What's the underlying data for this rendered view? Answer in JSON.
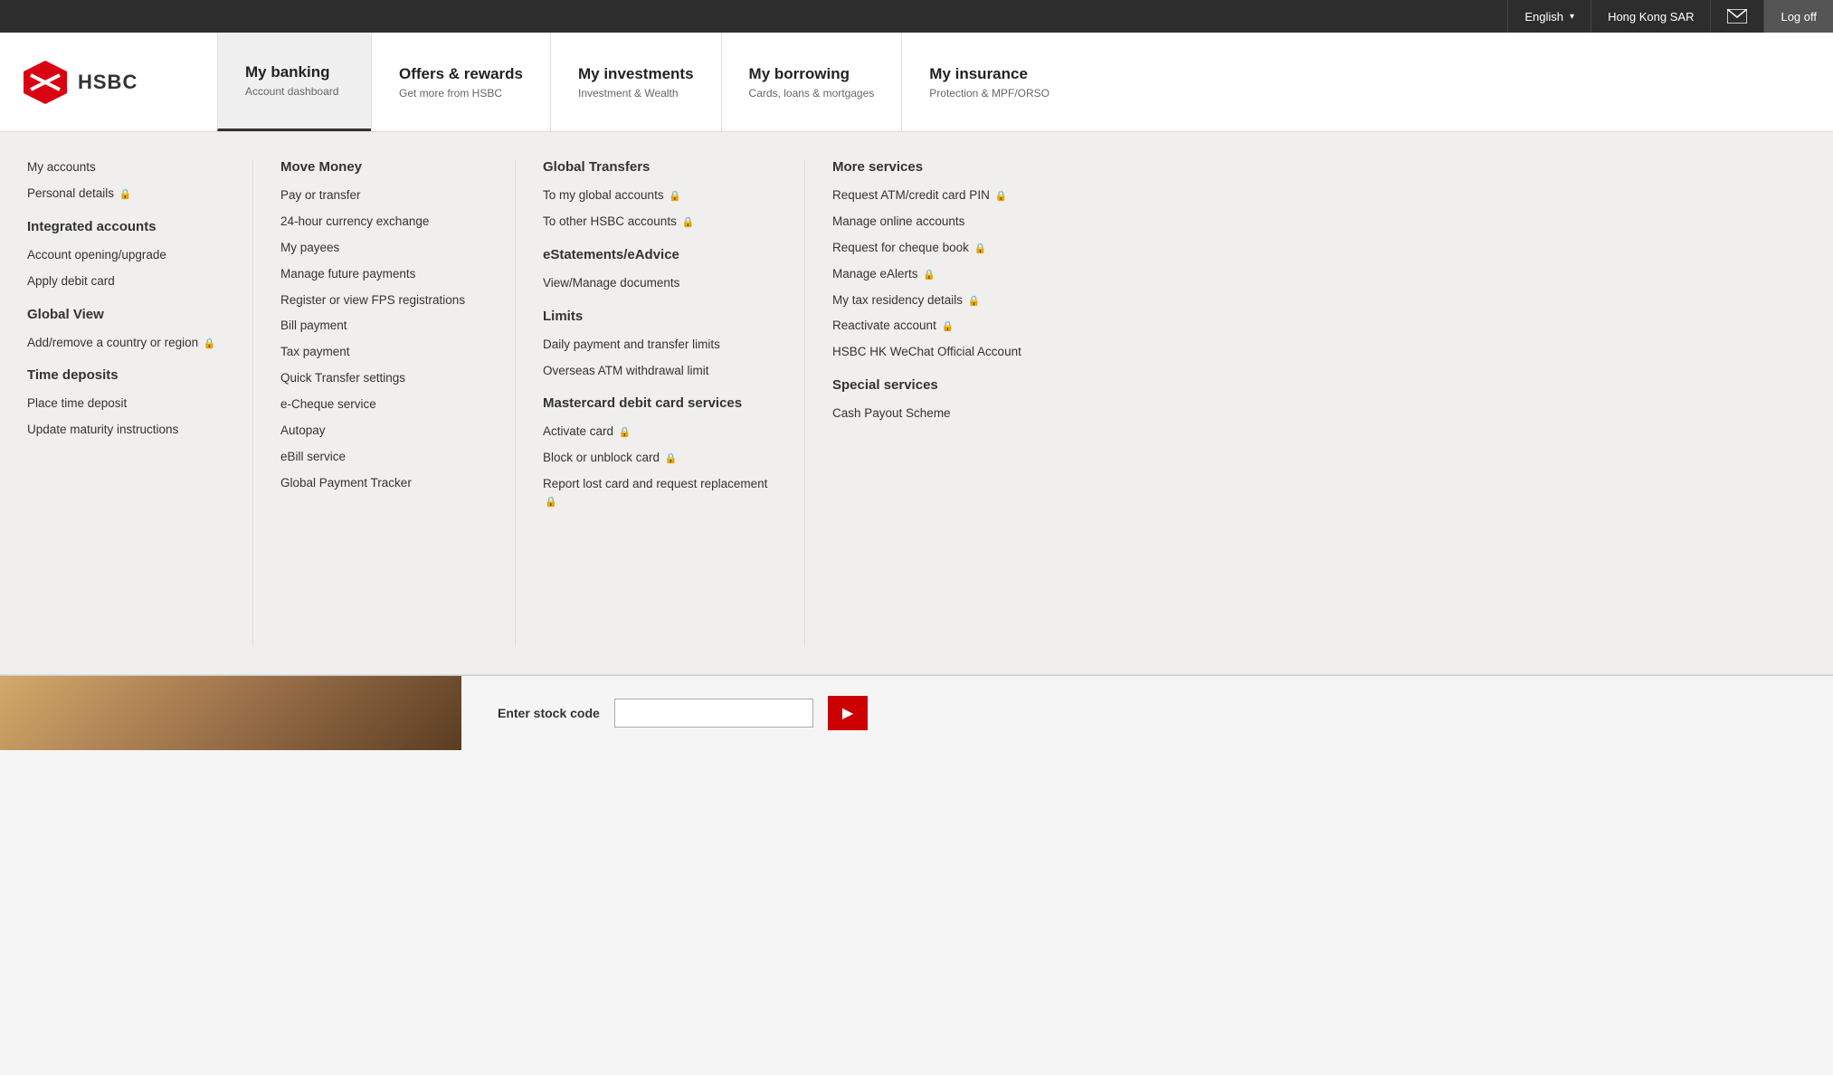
{
  "topbar": {
    "language_label": "English",
    "region_label": "Hong Kong SAR",
    "logoff_label": "Log off"
  },
  "navbar": {
    "logo_text": "HSBC",
    "items": [
      {
        "id": "my-banking",
        "title": "My banking",
        "subtitle": "Account dashboard",
        "active": true
      },
      {
        "id": "offers-rewards",
        "title": "Offers & rewards",
        "subtitle": "Get more from HSBC",
        "active": false
      },
      {
        "id": "my-investments",
        "title": "My investments",
        "subtitle": "Investment & Wealth",
        "active": false
      },
      {
        "id": "my-borrowing",
        "title": "My borrowing",
        "subtitle": "Cards, loans & mortgages",
        "active": false
      },
      {
        "id": "my-insurance",
        "title": "My insurance",
        "subtitle": "Protection & MPF/ORSO",
        "active": false
      }
    ]
  },
  "megamenu": {
    "col1": {
      "top_links": [
        {
          "id": "my-accounts",
          "text": "My accounts",
          "lock": false
        },
        {
          "id": "personal-details",
          "text": "Personal details",
          "lock": true
        }
      ],
      "sections": [
        {
          "id": "integrated-accounts",
          "title": "Integrated accounts",
          "links": [
            {
              "id": "account-opening",
              "text": "Account opening/upgrade",
              "lock": false
            },
            {
              "id": "apply-debit-card",
              "text": "Apply debit card",
              "lock": false
            }
          ]
        },
        {
          "id": "global-view",
          "title": "Global View",
          "links": [
            {
              "id": "add-remove-country",
              "text": "Add/remove a country or region",
              "lock": true
            }
          ]
        },
        {
          "id": "time-deposits",
          "title": "Time deposits",
          "links": [
            {
              "id": "place-time-deposit",
              "text": "Place time deposit",
              "lock": false
            },
            {
              "id": "update-maturity",
              "text": "Update maturity instructions",
              "lock": false
            }
          ]
        }
      ]
    },
    "col2": {
      "sections": [
        {
          "id": "move-money",
          "title": "Move Money",
          "links": [
            {
              "id": "pay-or-transfer",
              "text": "Pay or transfer",
              "lock": false
            },
            {
              "id": "currency-exchange",
              "text": "24-hour currency exchange",
              "lock": false
            },
            {
              "id": "my-payees",
              "text": "My payees",
              "lock": false
            },
            {
              "id": "manage-future-payments",
              "text": "Manage future payments",
              "lock": false
            },
            {
              "id": "register-fps",
              "text": "Register or view FPS registrations",
              "lock": false
            },
            {
              "id": "bill-payment",
              "text": "Bill payment",
              "lock": false
            },
            {
              "id": "tax-payment",
              "text": "Tax payment",
              "lock": false
            },
            {
              "id": "quick-transfer",
              "text": "Quick Transfer settings",
              "lock": false
            },
            {
              "id": "echeque",
              "text": "e-Cheque service",
              "lock": false
            },
            {
              "id": "autopay",
              "text": "Autopay",
              "lock": false
            },
            {
              "id": "ebill",
              "text": "eBill service",
              "lock": false
            },
            {
              "id": "global-payment-tracker",
              "text": "Global Payment Tracker",
              "lock": false
            }
          ]
        }
      ]
    },
    "col3": {
      "sections": [
        {
          "id": "global-transfers",
          "title": "Global Transfers",
          "links": [
            {
              "id": "to-my-global-accounts",
              "text": "To my global accounts",
              "lock": true
            },
            {
              "id": "to-other-hsbc",
              "text": "To other HSBC accounts",
              "lock": true
            }
          ]
        },
        {
          "id": "estatements",
          "title": "eStatements/eAdvice",
          "links": [
            {
              "id": "view-manage-docs",
              "text": "View/Manage documents",
              "lock": false
            }
          ]
        },
        {
          "id": "limits",
          "title": "Limits",
          "links": [
            {
              "id": "daily-payment-limits",
              "text": "Daily payment and transfer limits",
              "lock": false
            },
            {
              "id": "overseas-atm",
              "text": "Overseas ATM withdrawal limit",
              "lock": false
            }
          ]
        },
        {
          "id": "mastercard-debit",
          "title": "Mastercard debit card services",
          "links": [
            {
              "id": "activate-card",
              "text": "Activate card",
              "lock": true
            },
            {
              "id": "block-unblock",
              "text": "Block or unblock card",
              "lock": true
            },
            {
              "id": "report-lost",
              "text": "Report lost card and request replacement",
              "lock": true
            }
          ]
        }
      ]
    },
    "col4": {
      "sections": [
        {
          "id": "more-services",
          "title": "More services",
          "links": [
            {
              "id": "request-atm-pin",
              "text": "Request ATM/credit card PIN",
              "lock": true
            },
            {
              "id": "manage-online-accounts",
              "text": "Manage online accounts",
              "lock": false
            },
            {
              "id": "request-cheque-book",
              "text": "Request for cheque book",
              "lock": true
            },
            {
              "id": "manage-ealerts",
              "text": "Manage eAlerts",
              "lock": true
            },
            {
              "id": "tax-residency",
              "text": "My tax residency details",
              "lock": true
            },
            {
              "id": "reactivate-account",
              "text": "Reactivate account",
              "lock": true
            },
            {
              "id": "wechat",
              "text": "HSBC HK WeChat Official Account",
              "lock": false
            }
          ]
        },
        {
          "id": "special-services",
          "title": "Special services",
          "links": [
            {
              "id": "cash-payout",
              "text": "Cash Payout Scheme",
              "lock": false
            }
          ]
        }
      ]
    }
  },
  "bottom": {
    "stock_label": "Enter stock code",
    "stock_placeholder": "",
    "stock_btn": "▶"
  }
}
